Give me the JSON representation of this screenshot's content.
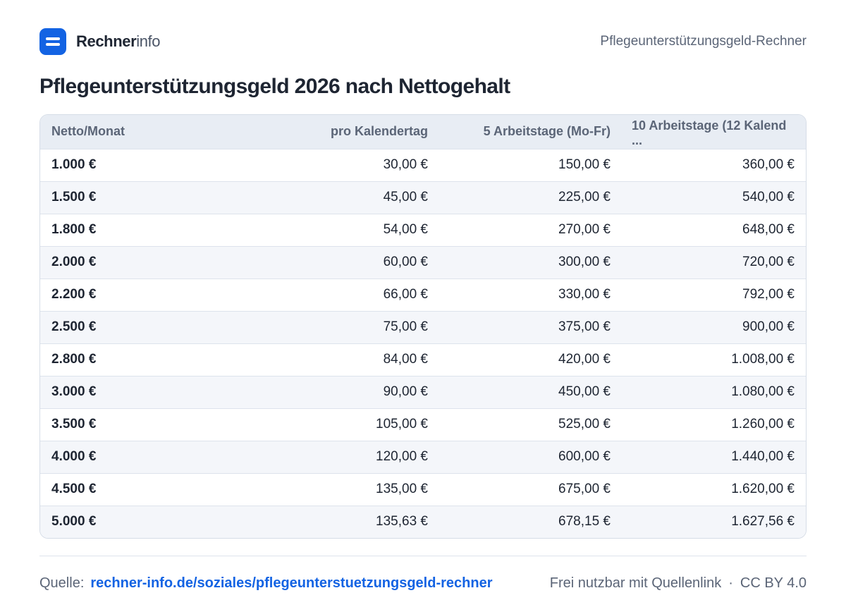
{
  "header": {
    "brand_strong": "Rechner",
    "brand_light": "info",
    "page_name": "Pflegeunterstützungsgeld-Rechner"
  },
  "title": "Pflegeunterstützungsgeld 2026 nach Nettogehalt",
  "table": {
    "headers": [
      "Netto/Monat",
      "pro Kalendertag",
      "5 Arbeitstage (Mo-Fr)",
      "10 Arbeitstage (12 Kalend ..."
    ],
    "rows": [
      [
        "1.000 €",
        "30,00 €",
        "150,00 €",
        "360,00 €"
      ],
      [
        "1.500 €",
        "45,00 €",
        "225,00 €",
        "540,00 €"
      ],
      [
        "1.800 €",
        "54,00 €",
        "270,00 €",
        "648,00 €"
      ],
      [
        "2.000 €",
        "60,00 €",
        "300,00 €",
        "720,00 €"
      ],
      [
        "2.200 €",
        "66,00 €",
        "330,00 €",
        "792,00 €"
      ],
      [
        "2.500 €",
        "75,00 €",
        "375,00 €",
        "900,00 €"
      ],
      [
        "2.800 €",
        "84,00 €",
        "420,00 €",
        "1.008,00 €"
      ],
      [
        "3.000 €",
        "90,00 €",
        "450,00 €",
        "1.080,00 €"
      ],
      [
        "3.500 €",
        "105,00 €",
        "525,00 €",
        "1.260,00 €"
      ],
      [
        "4.000 €",
        "120,00 €",
        "600,00 €",
        "1.440,00 €"
      ],
      [
        "4.500 €",
        "135,00 €",
        "675,00 €",
        "1.620,00 €"
      ],
      [
        "5.000 €",
        "135,63 €",
        "678,15 €",
        "1.627,56 €"
      ]
    ]
  },
  "footer": {
    "source_label": "Quelle:",
    "source_link": "rechner-info.de/soziales/pflegeunterstuetzungsgeld-rechner",
    "usage_note": "Frei nutzbar mit Quellenlink",
    "separator": "·",
    "license": "CC BY 4.0"
  },
  "colors": {
    "brand": "#1363e3",
    "header_bg": "#e8edf4",
    "row_alt": "#f4f6fa"
  },
  "icons": {
    "logo": "rechnerinfo-logo-icon"
  }
}
